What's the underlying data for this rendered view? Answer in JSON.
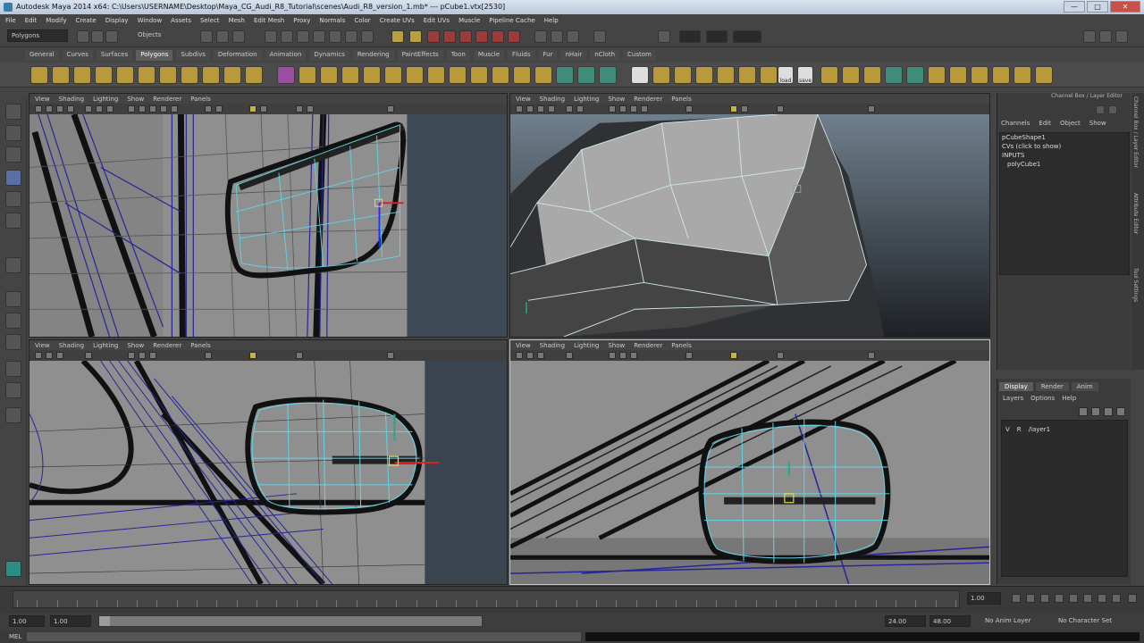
{
  "window": {
    "title": "Autodesk Maya 2014 x64: C:\\Users\\USERNAME\\Desktop\\Maya_CG_Audi_R8_Tutorial\\scenes\\Audi_R8_version_1.mb* --- pCube1.vtx[2530]",
    "min": "—",
    "max": "□",
    "close": "✕"
  },
  "menu": [
    "File",
    "Edit",
    "Modify",
    "Create",
    "Display",
    "Window",
    "Assets",
    "Select",
    "Mesh",
    "Edit Mesh",
    "Proxy",
    "Normals",
    "Color",
    "Create UVs",
    "Edit UVs",
    "Muscle",
    "Pipeline Cache",
    "Help"
  ],
  "statusline": {
    "mode": "Polygons",
    "objects": "Objects"
  },
  "shelf_tabs": [
    "General",
    "Curves",
    "Surfaces",
    "Polygons",
    "Subdivs",
    "Deformation",
    "Animation",
    "Dynamics",
    "Rendering",
    "PaintEffects",
    "Toon",
    "Muscle",
    "Fluids",
    "Fur",
    "nHair",
    "nCloth",
    "Custom"
  ],
  "shelf_text": {
    "load": "load",
    "save": "save"
  },
  "viewport_menu": [
    "View",
    "Shading",
    "Lighting",
    "Show",
    "Renderer",
    "Panels"
  ],
  "channel_box": {
    "header": "Channel Box / Layer Editor",
    "menu": [
      "Channels",
      "Edit",
      "Object",
      "Show"
    ],
    "lines": [
      "pCubeShape1",
      "CVs (click to show)",
      "INPUTS",
      "polyCube1"
    ]
  },
  "side_tabs": [
    "Channel Box / Layer Editor",
    "Attribute Editor",
    "Tool Settings"
  ],
  "layer_editor": {
    "tabs": [
      "Display",
      "Render",
      "Anim"
    ],
    "menu": [
      "Layers",
      "Options",
      "Help"
    ],
    "row_v": "V",
    "row_r": "R",
    "layer_name": "/layer1"
  },
  "time": {
    "current": "1.00",
    "range_start": "1.00",
    "range_inner_start": "1.00",
    "range_inner_end": "24.00",
    "range_end": "48.00",
    "anim_layer": "No Anim Layer",
    "char_set": "No Character Set"
  },
  "help_line": {
    "label": "MEL"
  },
  "colors": {
    "wire_blue": "#27249a",
    "wire_cyan": "#5fd6e8",
    "ui_bg": "#444444",
    "viewport_grey": "#8e8e8e"
  }
}
